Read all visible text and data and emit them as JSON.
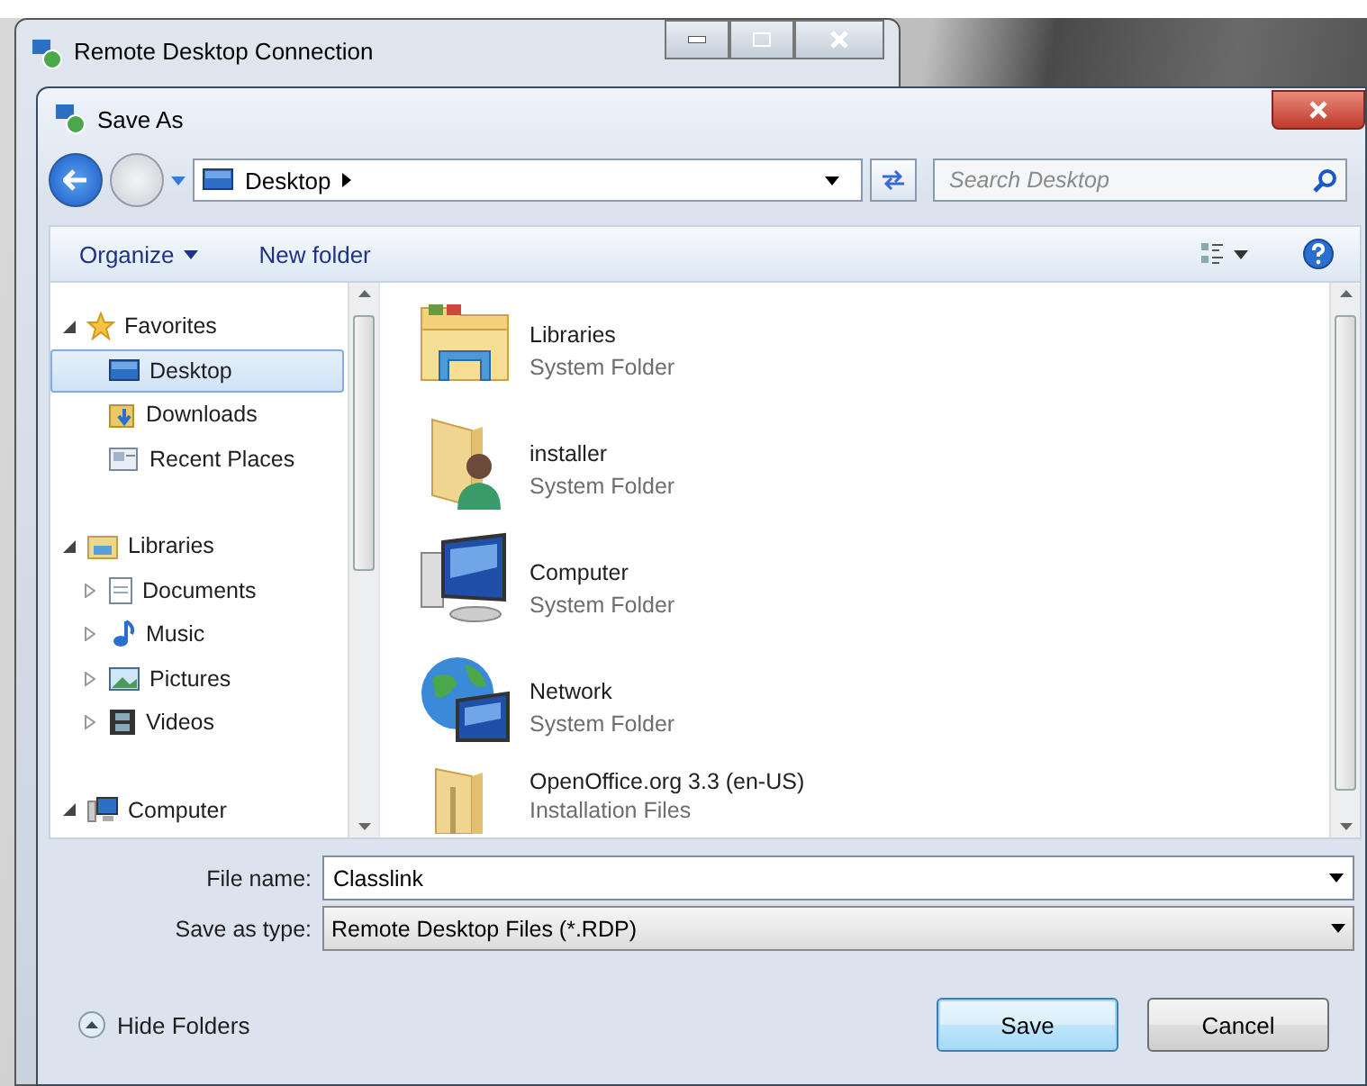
{
  "background_window": {
    "title": "Remote Desktop Connection"
  },
  "dialog": {
    "title": "Save As",
    "address": {
      "path": "Desktop"
    },
    "search": {
      "placeholder": "Search Desktop"
    },
    "toolbar": {
      "organize": "Organize",
      "new_folder": "New folder"
    },
    "nav_tree": [
      {
        "label": "Favorites",
        "expanded": true,
        "selected": false,
        "children": [
          {
            "label": "Desktop",
            "selected": true
          },
          {
            "label": "Downloads",
            "selected": false
          },
          {
            "label": "Recent Places",
            "selected": false
          }
        ]
      },
      {
        "label": "Libraries",
        "expanded": true,
        "selected": false,
        "children": [
          {
            "label": "Documents",
            "expanded": false,
            "selected": false
          },
          {
            "label": "Music",
            "expanded": false,
            "selected": false
          },
          {
            "label": "Pictures",
            "expanded": false,
            "selected": false
          },
          {
            "label": "Videos",
            "expanded": false,
            "selected": false
          }
        ]
      },
      {
        "label": "Computer",
        "expanded": true,
        "selected": false
      }
    ],
    "files": [
      {
        "name": "Libraries",
        "type": "System Folder"
      },
      {
        "name": "installer",
        "type": "System Folder"
      },
      {
        "name": "Computer",
        "type": "System Folder"
      },
      {
        "name": "Network",
        "type": "System Folder"
      },
      {
        "name": "OpenOffice.org 3.3 (en-US)",
        "type": "Installation Files"
      }
    ],
    "file_name": {
      "label": "File name:",
      "value": "Classlink"
    },
    "save_as_type": {
      "label": "Save as type:",
      "value": "Remote Desktop Files (*.RDP)"
    },
    "hide_folders": "Hide Folders",
    "buttons": [
      {
        "label": "Save",
        "default": true
      },
      {
        "label": "Cancel",
        "default": false
      }
    ]
  }
}
